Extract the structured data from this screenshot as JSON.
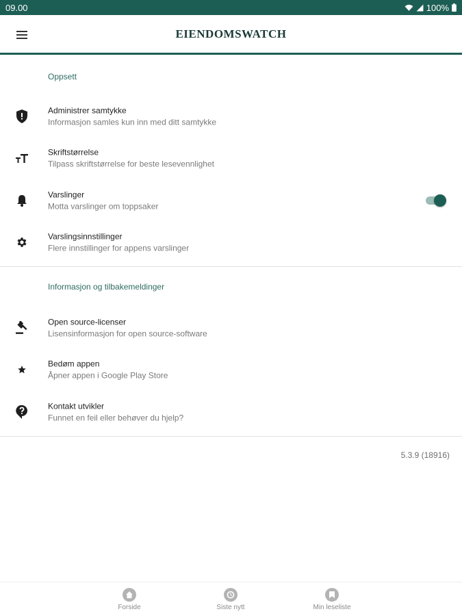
{
  "status_bar": {
    "time": "09.00",
    "battery": "100%",
    "icons": [
      "wifi-icon",
      "signal-icon",
      "battery-icon"
    ]
  },
  "app_bar": {
    "title": "EIENDOMSWATCH",
    "menu_icon": "menu-icon"
  },
  "sections": [
    {
      "header": "Oppsett",
      "items": [
        {
          "icon": "shield-icon",
          "title": "Administrer samtykke",
          "subtitle": "Informasjon samles kun inn med ditt samtykke"
        },
        {
          "icon": "font-size-icon",
          "title": "Skriftstørrelse",
          "subtitle": "Tilpass skriftstørrelse for beste lesevennlighet"
        },
        {
          "icon": "bell-icon",
          "title": "Varslinger",
          "subtitle": "Motta varslinger om toppsaker",
          "toggle": true
        },
        {
          "icon": "gear-icon",
          "title": "Varslingsinnstillinger",
          "subtitle": "Flere innstillinger for appens varslinger"
        }
      ]
    },
    {
      "header": "Informasjon og tilbakemeldinger",
      "items": [
        {
          "icon": "gavel-icon",
          "title": "Open source-licenser",
          "subtitle": "Lisensinformasjon for open source-software"
        },
        {
          "icon": "star-icon",
          "title": "Bedøm appen",
          "subtitle": "Åpner appen i Google Play Store"
        },
        {
          "icon": "help-icon",
          "title": "Kontakt utvikler",
          "subtitle": "Funnet en feil eller behøver du hjelp?"
        }
      ]
    }
  ],
  "version": "5.3.9 (18916)",
  "bottom_nav": [
    {
      "label": "Forside",
      "icon": "home-icon"
    },
    {
      "label": "Siste nytt",
      "icon": "clock-icon"
    },
    {
      "label": "Min leseliste",
      "icon": "bookmark-icon"
    }
  ],
  "colors": {
    "brand": "#1d5e54",
    "toggle_track": "#9cbcb6",
    "section_header": "#2e6b61",
    "nav_icon": "#b3b3b3"
  }
}
